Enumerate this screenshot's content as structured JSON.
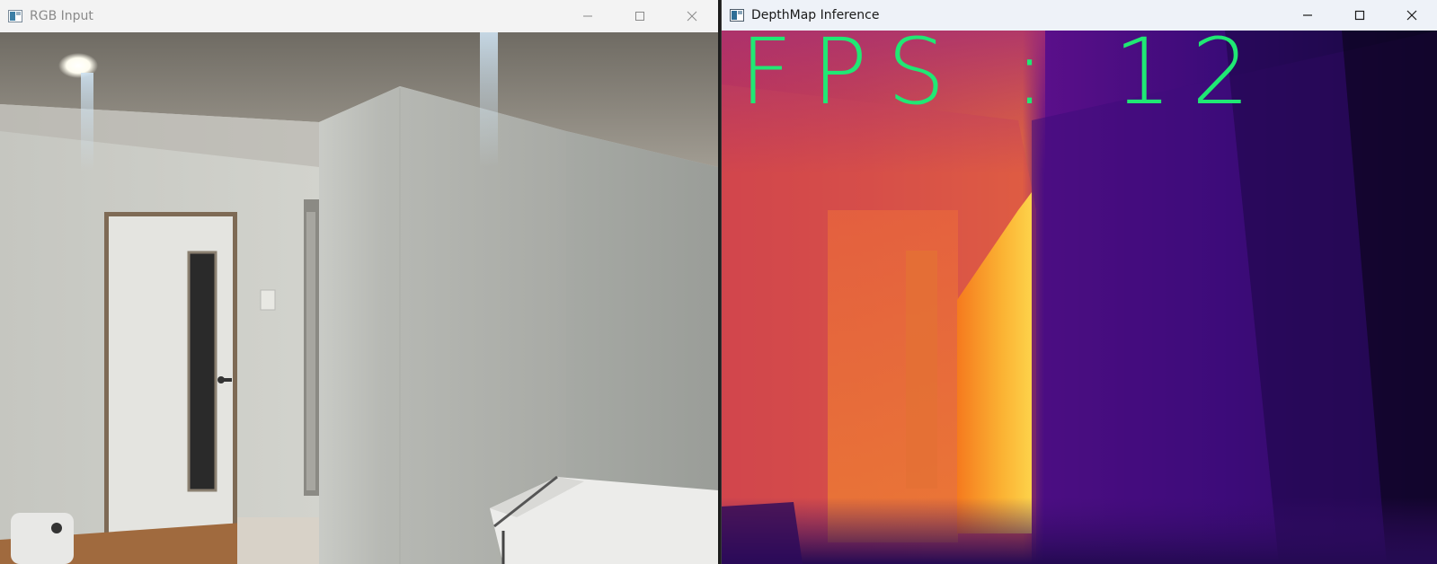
{
  "rgb_window": {
    "title": "RGB Input",
    "icon": "window-app-icon",
    "controls": [
      "minimize-icon",
      "maximize-icon",
      "close-icon"
    ]
  },
  "depth_window": {
    "title": "DepthMap Inference",
    "icon": "window-app-icon",
    "controls": [
      "minimize-icon",
      "maximize-icon",
      "close-icon"
    ],
    "overlay_text": "FPS : 12",
    "overlay_color": "#20e874"
  },
  "colors": {
    "inactive_title": "#8a8a8a",
    "active_title": "#1a1a1a"
  }
}
